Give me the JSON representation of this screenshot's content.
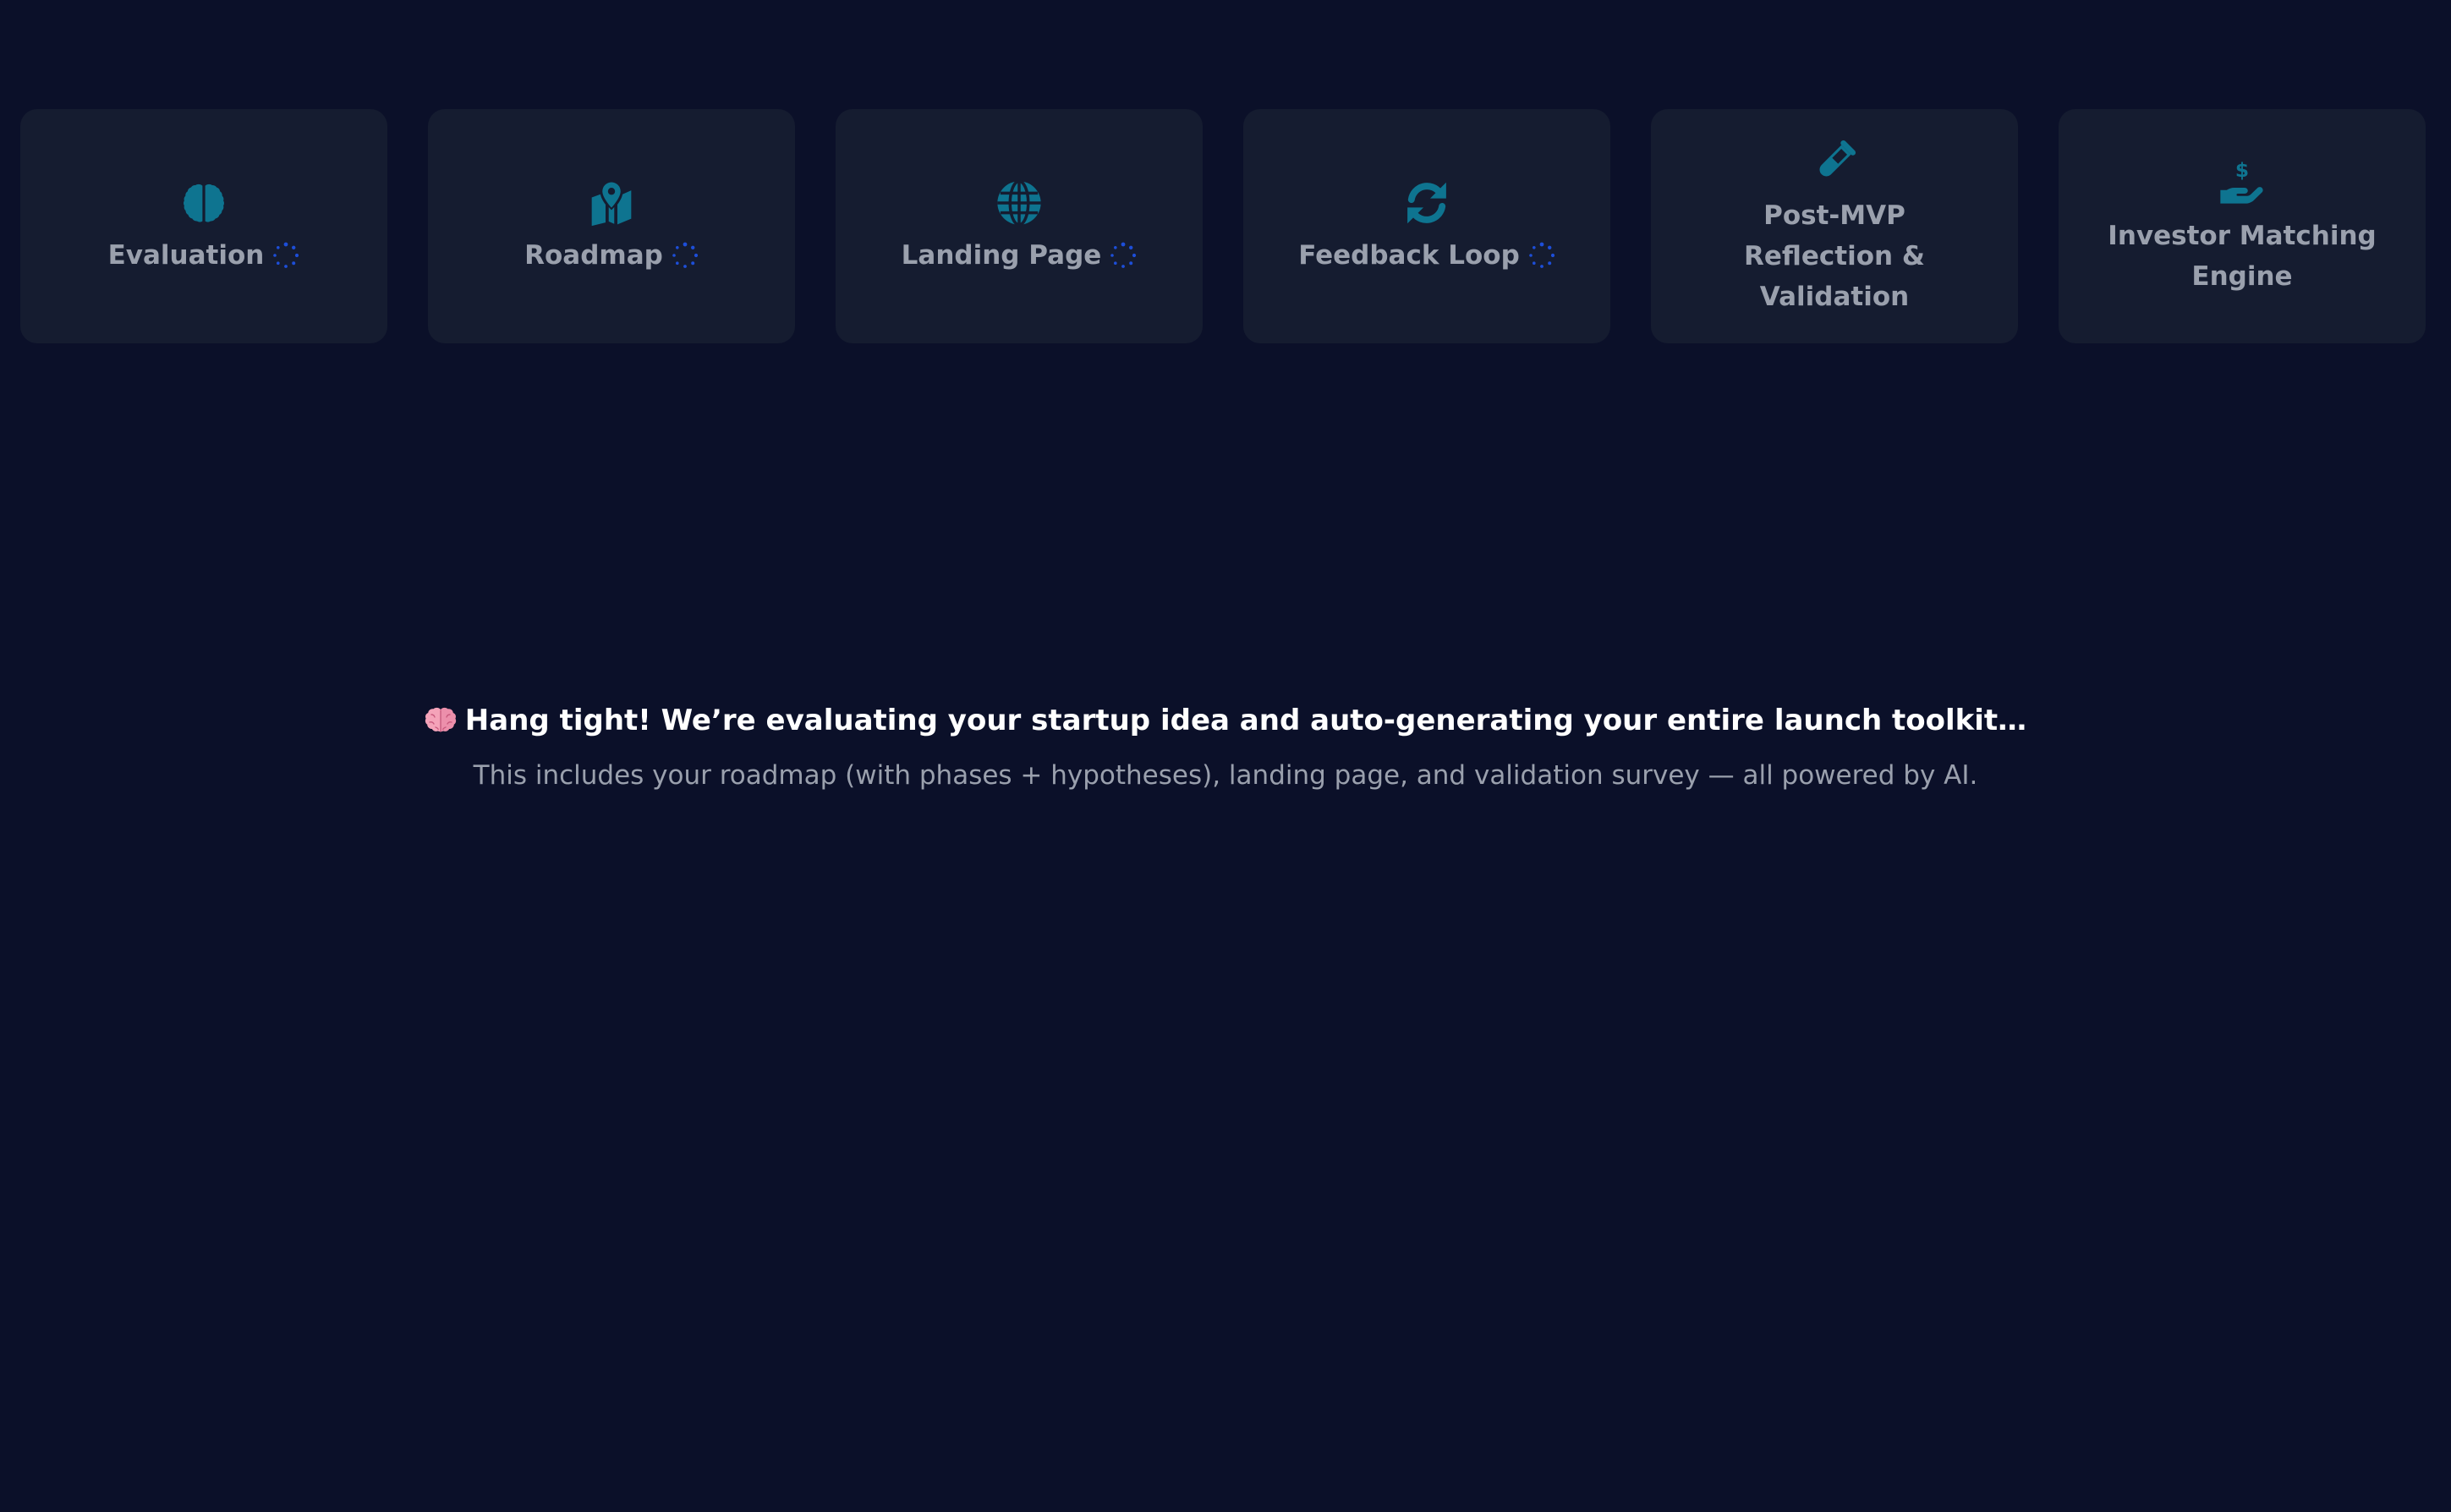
{
  "colors": {
    "background": "#0b1029",
    "card": "#151c30",
    "icon": "#0e7490",
    "spinner": "#1d4ed8",
    "label": "#9aa0ad",
    "headline": "#ffffff"
  },
  "steps": [
    {
      "label": "Evaluation",
      "icon": "brain-icon",
      "loading": true
    },
    {
      "label": "Roadmap",
      "icon": "map-location-icon",
      "loading": true
    },
    {
      "label": "Landing Page",
      "icon": "globe-icon",
      "loading": true
    },
    {
      "label": "Feedback Loop",
      "icon": "refresh-icon",
      "loading": true
    },
    {
      "label": "Post-MVP Reflection & Validation",
      "icon": "test-tube-icon",
      "loading": false
    },
    {
      "label": "Investor Matching Engine",
      "icon": "hand-dollar-icon",
      "loading": false
    }
  ],
  "loading": {
    "emoji": "brain-emoji",
    "headline": "Hang tight! We’re evaluating your startup idea and auto-generating your entire launch toolkit…",
    "subline": "This includes your roadmap (with phases + hypotheses), landing page, and validation survey — all powered by AI."
  }
}
